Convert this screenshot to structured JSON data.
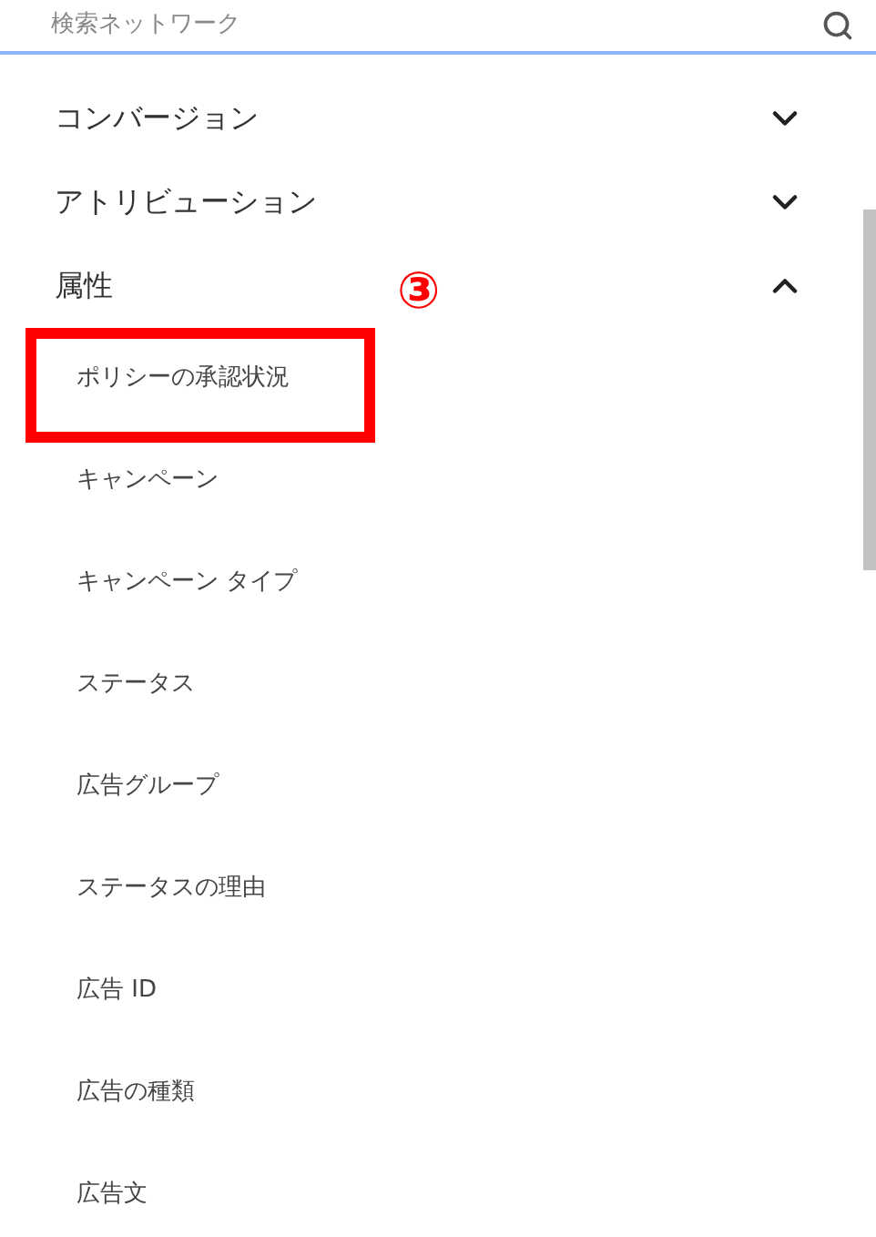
{
  "search": {
    "placeholder": "検索ネットワーク"
  },
  "sections": [
    {
      "label": "コンバージョン",
      "expanded": false
    },
    {
      "label": "アトリビューション",
      "expanded": false
    },
    {
      "label": "属性",
      "expanded": true,
      "children": [
        {
          "label": "ポリシーの承認状況"
        },
        {
          "label": "キャンペーン"
        },
        {
          "label": "キャンペーン タイプ"
        },
        {
          "label": "ステータス"
        },
        {
          "label": "広告グループ"
        },
        {
          "label": "ステータスの理由"
        },
        {
          "label": "広告 ID"
        },
        {
          "label": "広告の種類"
        },
        {
          "label": "広告文"
        }
      ]
    }
  ],
  "annotation": {
    "label": "③"
  }
}
